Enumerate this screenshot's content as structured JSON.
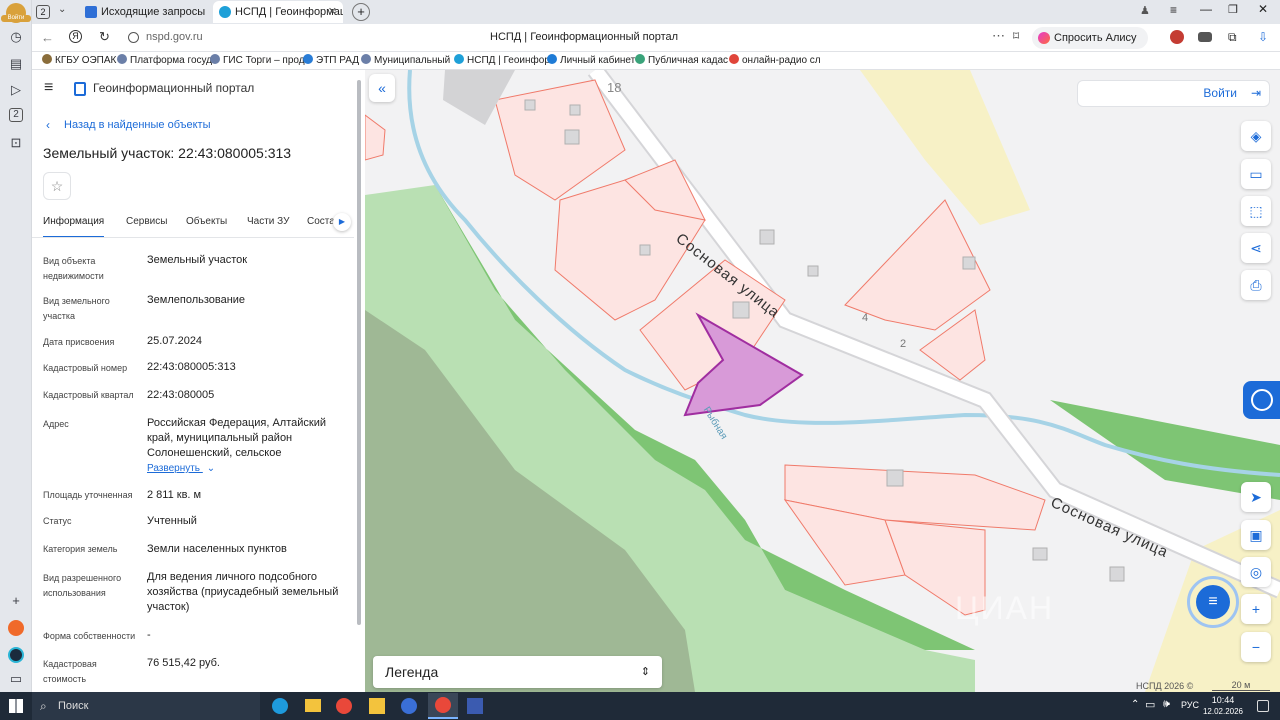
{
  "browser": {
    "profile_label": "Войти",
    "tab_count_badge": "2",
    "tabs": [
      {
        "label": "Исходящие запросы СМЭ",
        "active": false
      },
      {
        "label": "НСПД | Геоинформаци",
        "active": true
      }
    ],
    "address_url": "nspd.gov.ru",
    "page_title": "НСПД | Геоинформационный портал",
    "alice_button": "Спросить Алису AI",
    "sidebar_badge": "2",
    "bookmarks": [
      "КГБУ ОЭПАК",
      "Платформа госуд",
      "ГИС Торги – прод",
      "ЭТП РАД",
      "Муниципальный",
      "НСПД | Геоинфор",
      "Личный кабинет",
      "Публичная кадас",
      "онлайн-радио сл"
    ]
  },
  "portal": {
    "title": "Геоинформационный портал",
    "back_link": "Назад в найденные объекты",
    "object_title": "Земельный участок: 22:43:080005:313"
  },
  "tabs": [
    "Информация",
    "Сервисы",
    "Объекты",
    "Части ЗУ",
    "Соста"
  ],
  "fields": [
    {
      "label": "Вид объекта недвижимости",
      "value": "Земельный участок"
    },
    {
      "label": "Вид земельного участка",
      "value": "Землепользование"
    },
    {
      "label": "Дата присвоения",
      "value": "25.07.2024"
    },
    {
      "label": "Кадастровый номер",
      "value": "22:43:080005:313"
    },
    {
      "label": "Кадастровый квартал",
      "value": "22:43:080005"
    },
    {
      "label": "Адрес",
      "value": "Российская Федерация, Алтайский край, муниципальный район Солонешенский, сельское"
    },
    {
      "label": "Площадь уточненная",
      "value": "2 811 кв. м"
    },
    {
      "label": "Статус",
      "value": "Учтенный"
    },
    {
      "label": "Категория земель",
      "value": "Земли населенных пунктов"
    },
    {
      "label": "Вид разрешенного использования",
      "value": "Для ведения личного подсобного хозяйства (приусадебный земельный участок)"
    },
    {
      "label": "Форма собственности",
      "value": "-"
    },
    {
      "label": "Кадастровая стоимость",
      "value": "76 515,42 руб."
    }
  ],
  "expand_link": "Развернуть",
  "map": {
    "login_button": "Войти",
    "legend_label": "Легенда",
    "street_label": "Сосновая улица",
    "river_label": "Рыбная",
    "house_numbers": [
      "18",
      "4",
      "2"
    ],
    "copyright": "НСПД 2026 ©",
    "scale_label": "20 м",
    "watermark": "ЦИАН"
  },
  "taskbar": {
    "search_placeholder": "Поиск",
    "language": "РУС",
    "time": "10:44",
    "date": "12.02.2026"
  },
  "colors": {
    "accent": "#1c6bd8",
    "selected_parcel": "#d89ad8",
    "parcel_fill": "#fde4e2",
    "parcel_stroke": "#f07a6a",
    "forest": "#6cbb62",
    "taskbar": "#1f2a38"
  }
}
